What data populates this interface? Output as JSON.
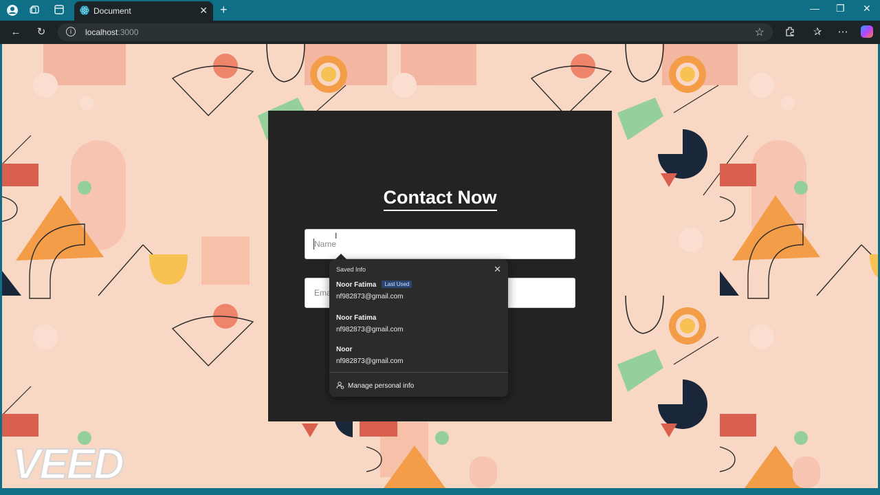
{
  "browser": {
    "tab_title": "Document",
    "url_host": "localhost",
    "url_port": ":3000"
  },
  "page": {
    "title": "Contact Now",
    "name_placeholder": "Name",
    "email_placeholder": "Ema"
  },
  "autofill": {
    "header": "Saved Info",
    "entries": [
      {
        "name": "Noor Fatima",
        "badge": "Last Used",
        "email": "nf982873@gmail.com"
      },
      {
        "name": "Noor Fatima",
        "email": "nf982873@gmail.com"
      },
      {
        "name": "Noor",
        "email": "nf982873@gmail.com"
      }
    ],
    "manage_label": "Manage personal info"
  },
  "watermark": "VEED",
  "colors": {
    "chrome": "#0e6f86",
    "toolbar": "#1d2428",
    "background": "#f8d7c4",
    "card": "#232323",
    "popup": "#2b2b2b"
  }
}
